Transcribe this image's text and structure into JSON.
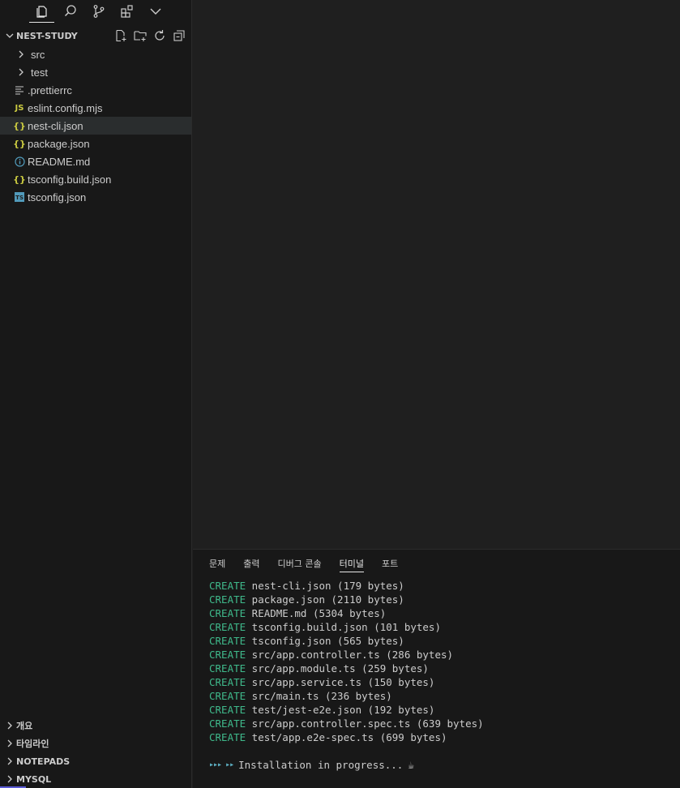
{
  "sidebar": {
    "explorer_title": "NEST-STUDY",
    "tree": [
      {
        "label": "src",
        "type": "folder"
      },
      {
        "label": "test",
        "type": "folder"
      },
      {
        "label": ".prettierrc",
        "type": "file",
        "icon": "lines-icon"
      },
      {
        "label": "eslint.config.mjs",
        "type": "file",
        "icon": "js-icon",
        "icon_text": "JS"
      },
      {
        "label": "nest-cli.json",
        "type": "file",
        "icon": "json-icon",
        "icon_text": "{}",
        "selected": true
      },
      {
        "label": "package.json",
        "type": "file",
        "icon": "json-icon",
        "icon_text": "{}"
      },
      {
        "label": "README.md",
        "type": "file",
        "icon": "info-icon"
      },
      {
        "label": "tsconfig.build.json",
        "type": "file",
        "icon": "json-icon",
        "icon_text": "{}"
      },
      {
        "label": "tsconfig.json",
        "type": "file",
        "icon": "ts-icon",
        "icon_text": "TS"
      }
    ],
    "bottom_sections": [
      {
        "label": "개요"
      },
      {
        "label": "타임라인"
      },
      {
        "label": "NOTEPADS"
      },
      {
        "label": "MYSQL"
      }
    ]
  },
  "panel": {
    "tabs": [
      {
        "label": "문제"
      },
      {
        "label": "출력"
      },
      {
        "label": "디버그 콘솔"
      },
      {
        "label": "터미널",
        "active": true
      },
      {
        "label": "포트"
      }
    ],
    "terminal_lines": [
      {
        "kw": "CREATE",
        "text": " nest-cli.json (179 bytes)"
      },
      {
        "kw": "CREATE",
        "text": " package.json (2110 bytes)"
      },
      {
        "kw": "CREATE",
        "text": " README.md (5304 bytes)"
      },
      {
        "kw": "CREATE",
        "text": " tsconfig.build.json (101 bytes)"
      },
      {
        "kw": "CREATE",
        "text": " tsconfig.json (565 bytes)"
      },
      {
        "kw": "CREATE",
        "text": " src/app.controller.ts (286 bytes)"
      },
      {
        "kw": "CREATE",
        "text": " src/app.module.ts (259 bytes)"
      },
      {
        "kw": "CREATE",
        "text": " src/app.service.ts (150 bytes)"
      },
      {
        "kw": "CREATE",
        "text": " src/main.ts (236 bytes)"
      },
      {
        "kw": "CREATE",
        "text": " test/jest-e2e.json (192 bytes)"
      },
      {
        "kw": "CREATE",
        "text": " src/app.controller.spec.ts (639 bytes)"
      },
      {
        "kw": "CREATE",
        "text": " test/app.e2e-spec.ts (699 bytes)"
      }
    ],
    "progress_arrows": "▸▸▸ ▸▸",
    "progress_text": "Installation in progress...",
    "progress_emoji": "☕"
  },
  "colors": {
    "create_keyword": "#3fb98b",
    "json_icon": "#cbcb41",
    "js_icon": "#cbcb41",
    "info_icon": "#519aba",
    "ts_icon": "#519aba"
  }
}
